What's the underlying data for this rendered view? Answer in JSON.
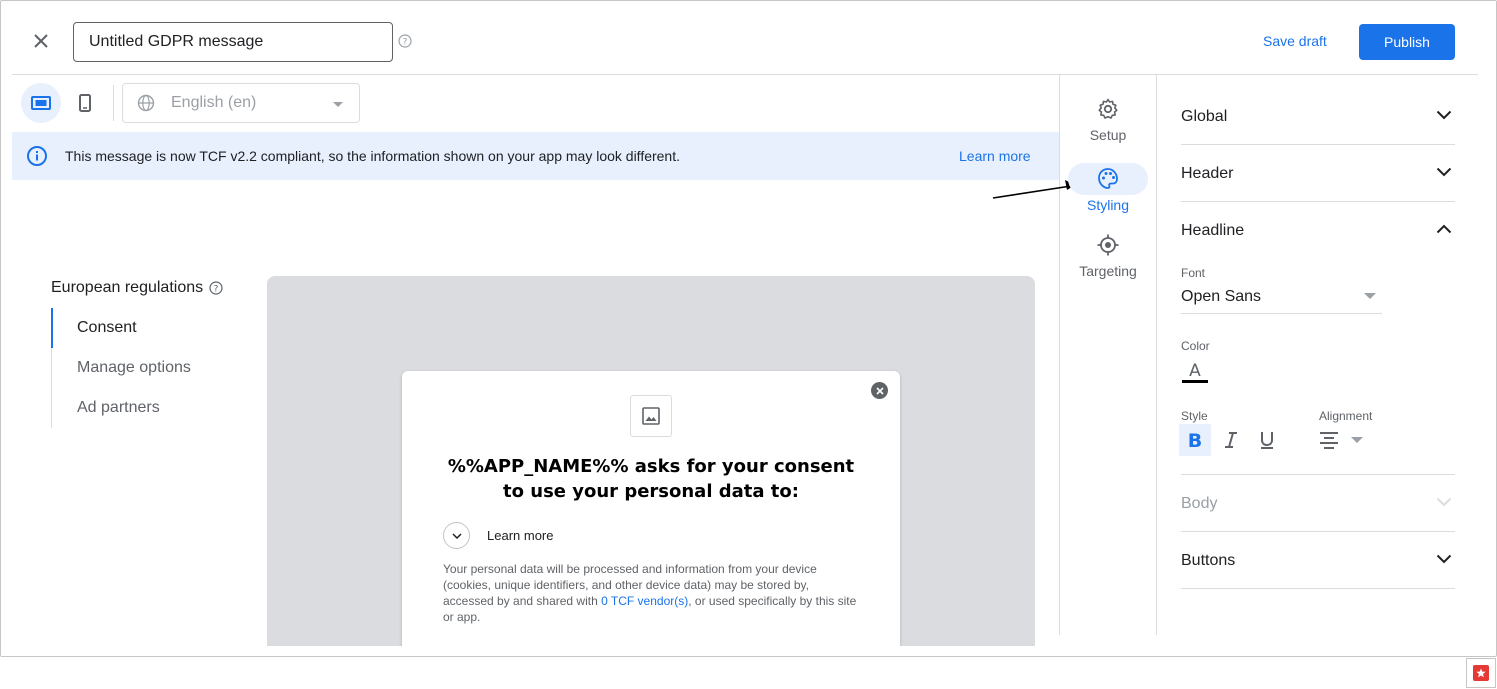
{
  "topbar": {
    "title_value": "Untitled GDPR message",
    "save_draft_label": "Save draft",
    "publish_label": "Publish"
  },
  "toolbar": {
    "language": "English (en)"
  },
  "banner": {
    "text": "This message is now TCF v2.2 compliant, so the information shown on your app may look different.",
    "link": "Learn more"
  },
  "nav": {
    "title": "European regulations",
    "items": [
      {
        "label": "Consent",
        "active": true
      },
      {
        "label": "Manage options",
        "active": false
      },
      {
        "label": "Ad partners",
        "active": false
      }
    ]
  },
  "preview": {
    "title": "%%APP_NAME%% asks for your consent to use your personal data to:",
    "learn_more": "Learn more",
    "body_before": "Your personal data will be processed and information from your device (cookies, unique identifiers, and other device data) may be stored by, accessed by and shared with ",
    "vendor_link": "0 TCF vendor(s)",
    "body_after": ", or used specifically by this site or app."
  },
  "tabs": {
    "setup": "Setup",
    "styling": "Styling",
    "targeting": "Targeting"
  },
  "panel": {
    "global": "Global",
    "header": "Header",
    "headline": "Headline",
    "font_label": "Font",
    "font_value": "Open Sans",
    "color_label": "Color",
    "style_label": "Style",
    "alignment_label": "Alignment",
    "body": "Body",
    "buttons": "Buttons"
  },
  "colors": {
    "accent": "#1a73e8",
    "banner_bg": "#e8f0fe",
    "preview_bg": "#dadce0"
  }
}
